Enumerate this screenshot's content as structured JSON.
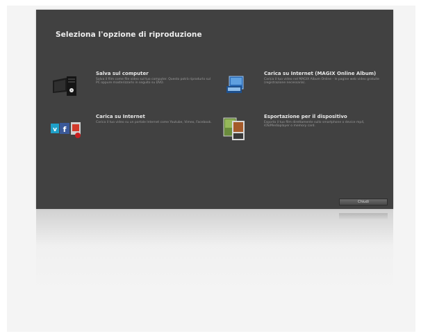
{
  "dialog": {
    "title": "Seleziona l'opzione di riproduzione",
    "close_label": "Chiudi"
  },
  "options": [
    {
      "title": "Salva sul computer",
      "description": "Salva il film come file video sul tuo computer. Questo potrà riprodurlo sul PC oppure masterizzarlo in seguito su DVD.",
      "icon": "computer-icon"
    },
    {
      "title": "Carica su Internet (MAGIX Online Album)",
      "description": "Carica il tuo video nel MAGIX Album Online - le pagine web video gratuite (registrazione necessaria).",
      "icon": "magix-online-album-icon"
    },
    {
      "title": "Carica su Internet",
      "description": "Carica il tuo video su un portale Internet come Youtube, Vimeo, Facebook.",
      "icon": "social-portals-icon"
    },
    {
      "title": "Esportazione per il dispositivo",
      "description": "Esporta il tuo film direttamente sullo smartphone o device mp4, iOS/Mediaplayer o memory card.",
      "icon": "device-export-icon"
    }
  ]
}
